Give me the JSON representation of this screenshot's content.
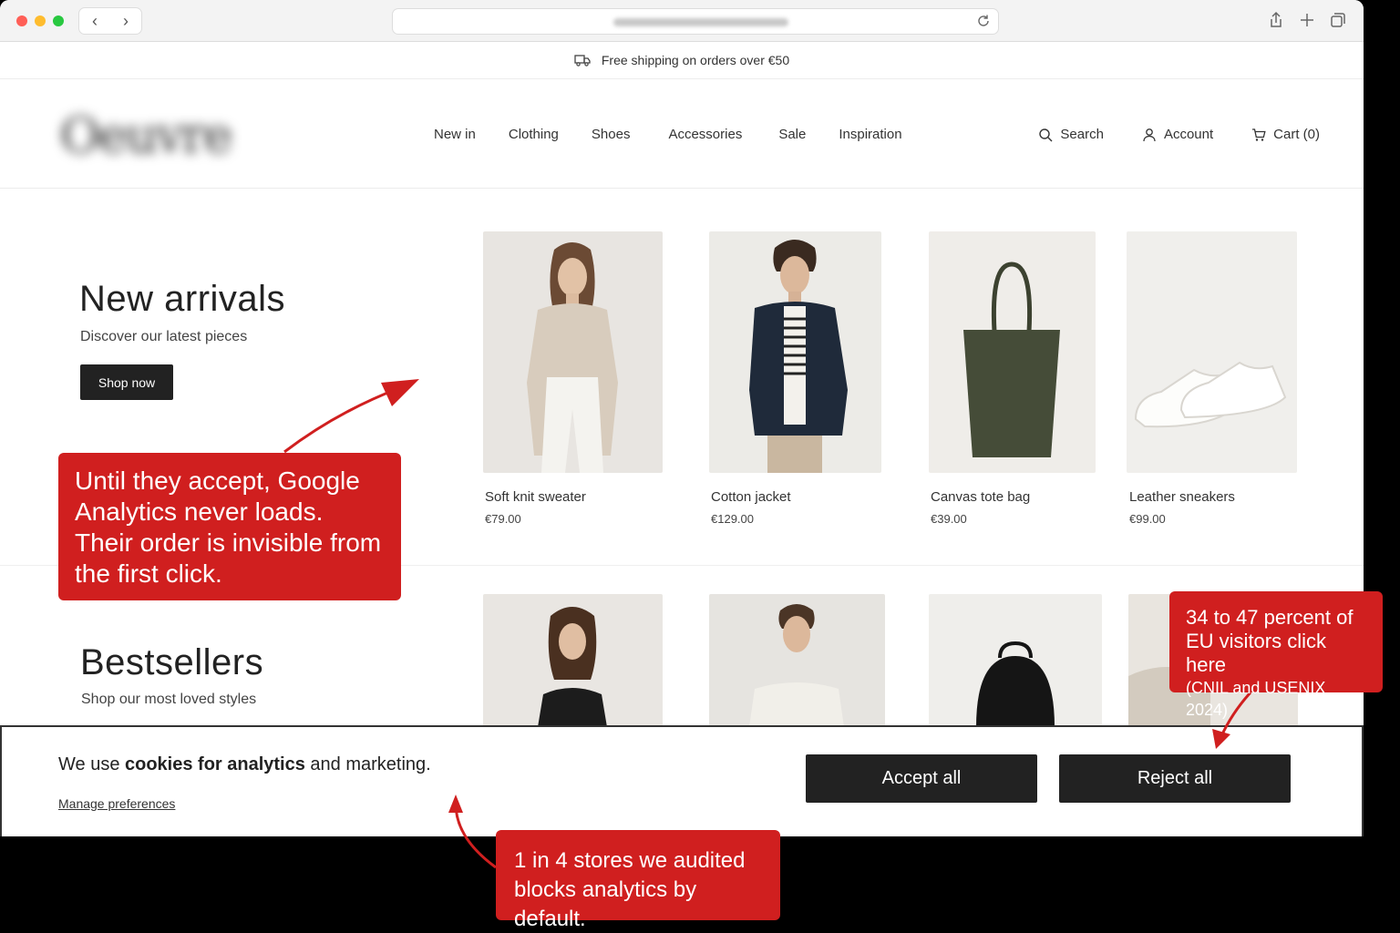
{
  "browser": {
    "back_label": "‹",
    "forward_label": "›"
  },
  "promo": {
    "text": "Free shipping on orders over €50"
  },
  "header": {
    "logo": "Oeuvre",
    "nav": [
      "New in",
      "Clothing",
      "Shoes",
      "Accessories",
      "Sale",
      "Inspiration"
    ],
    "search_label": "Search",
    "account_label": "Account",
    "cart_label": "Cart (0)"
  },
  "hero": {
    "title": "New arrivals",
    "subtitle": "Discover our latest pieces",
    "cta": "Shop now",
    "products": [
      {
        "name": "Soft knit sweater",
        "price": "€79.00"
      },
      {
        "name": "Cotton jacket",
        "price": "€129.00"
      },
      {
        "name": "Canvas tote bag",
        "price": "€39.00"
      },
      {
        "name": "Leather sneakers",
        "price": "€99.00"
      }
    ]
  },
  "bestsellers": {
    "title": "Bestsellers",
    "subtitle": "Shop our most loved styles"
  },
  "cookie": {
    "text_part1": "We use ",
    "text_bold1": "cookies for analytics",
    "text_part2": " and marketing.",
    "manage": "Manage preferences",
    "accept": "Accept all",
    "reject": "Reject all"
  },
  "callouts": {
    "analytics": "Until they accept, Google Analytics never loads. Their order is invisible from the first click.",
    "reject_stat_1": "34 to 47 percent of",
    "reject_stat_2": "EU visitors click here",
    "reject_source": "(CNIL and USENIX 2024)",
    "stores_1": "1 in 4 stores we audited",
    "stores_2": "blocks analytics by default."
  },
  "colors": {
    "callout_red": "#d01f1f",
    "button_dark": "#222222"
  }
}
